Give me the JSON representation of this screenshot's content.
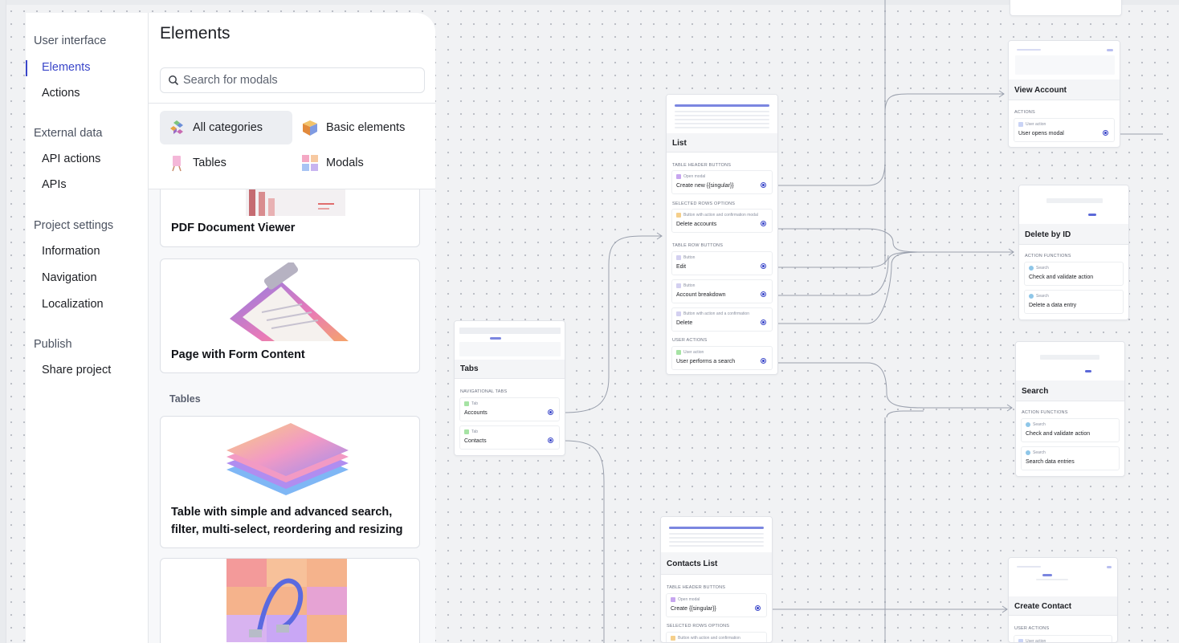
{
  "nav": {
    "sections": [
      {
        "label": "User interface",
        "items": [
          {
            "label": "Elements",
            "active": true
          },
          {
            "label": "Actions"
          }
        ]
      },
      {
        "label": "External data",
        "items": [
          {
            "label": "API actions"
          },
          {
            "label": "APIs"
          }
        ]
      },
      {
        "label": "Project settings",
        "items": [
          {
            "label": "Information"
          },
          {
            "label": "Navigation"
          },
          {
            "label": "Localization"
          }
        ]
      },
      {
        "label": "Publish",
        "items": [
          {
            "label": "Share project"
          }
        ]
      }
    ]
  },
  "panel": {
    "title": "Elements",
    "search_placeholder": "Search for modals",
    "categories": [
      {
        "label": "All categories",
        "icon": "cubes-icon",
        "selected": true
      },
      {
        "label": "Basic elements",
        "icon": "cube-icon"
      },
      {
        "label": "Tables",
        "icon": "easel-icon"
      },
      {
        "label": "Modals",
        "icon": "grid-icon"
      }
    ],
    "cards": [
      {
        "title": "PDF Document Viewer"
      },
      {
        "title": "Page with Form Content"
      },
      {
        "title": "Table with simple and advanced search, filter, multi-select, reordering and resizing"
      }
    ],
    "section_label": "Tables"
  },
  "flow": {
    "tabs": {
      "title": "Tabs",
      "group": "NAVIGATIONAL TABS",
      "rows": [
        {
          "kind": "Tab",
          "label": "Accounts"
        },
        {
          "kind": "Tab",
          "label": "Contacts"
        }
      ]
    },
    "list": {
      "title": "List",
      "groups": [
        {
          "label": "TABLE HEADER BUTTONS",
          "rows": [
            {
              "kind": "Open modal",
              "label": "Create new {{singular}}"
            }
          ]
        },
        {
          "label": "SELECTED ROWS OPTIONS",
          "rows": [
            {
              "kind": "Button with action and confirmation modal",
              "label": "Delete accounts"
            }
          ]
        },
        {
          "label": "TABLE ROW BUTTONS",
          "rows": [
            {
              "kind": "Button",
              "label": "Edit"
            },
            {
              "kind": "Button",
              "label": "Account breakdown"
            },
            {
              "kind": "Button with action and a confirmation",
              "label": "Delete"
            }
          ]
        },
        {
          "label": "USER ACTIONS",
          "rows": [
            {
              "kind": "User action",
              "label": "User performs a search"
            }
          ]
        }
      ]
    },
    "contacts_list": {
      "title": "Contacts List",
      "groups": [
        {
          "label": "TABLE HEADER BUTTONS",
          "rows": [
            {
              "kind": "Open modal",
              "label": "Create {{singular}}"
            }
          ]
        },
        {
          "label": "SELECTED ROWS OPTIONS",
          "rows": [
            {
              "kind": "Button with action and confirmation",
              "label": ""
            }
          ]
        }
      ]
    },
    "view_account": {
      "title": "View Account",
      "group": "ACTIONS",
      "rows": [
        {
          "kind": "User action",
          "label": "User opens modal"
        }
      ]
    },
    "delete_by_id": {
      "title": "Delete by ID",
      "group": "ACTION FUNCTIONS",
      "rows": [
        {
          "kind": "Search",
          "label": "Check and validate action"
        },
        {
          "kind": "Search",
          "label": "Delete a data entry"
        }
      ]
    },
    "search": {
      "title": "Search",
      "group": "ACTION FUNCTIONS",
      "rows": [
        {
          "kind": "Search",
          "label": "Check and validate action"
        },
        {
          "kind": "Search",
          "label": "Search data entries"
        }
      ]
    },
    "create_contact": {
      "title": "Create Contact",
      "group": "USER ACTIONS",
      "rows": [
        {
          "kind": "User action",
          "label": ""
        }
      ]
    }
  },
  "colors": {
    "accent": "#3a46c9",
    "canvas_bg": "#f1f2f4",
    "wire": "#9aa0ad"
  }
}
